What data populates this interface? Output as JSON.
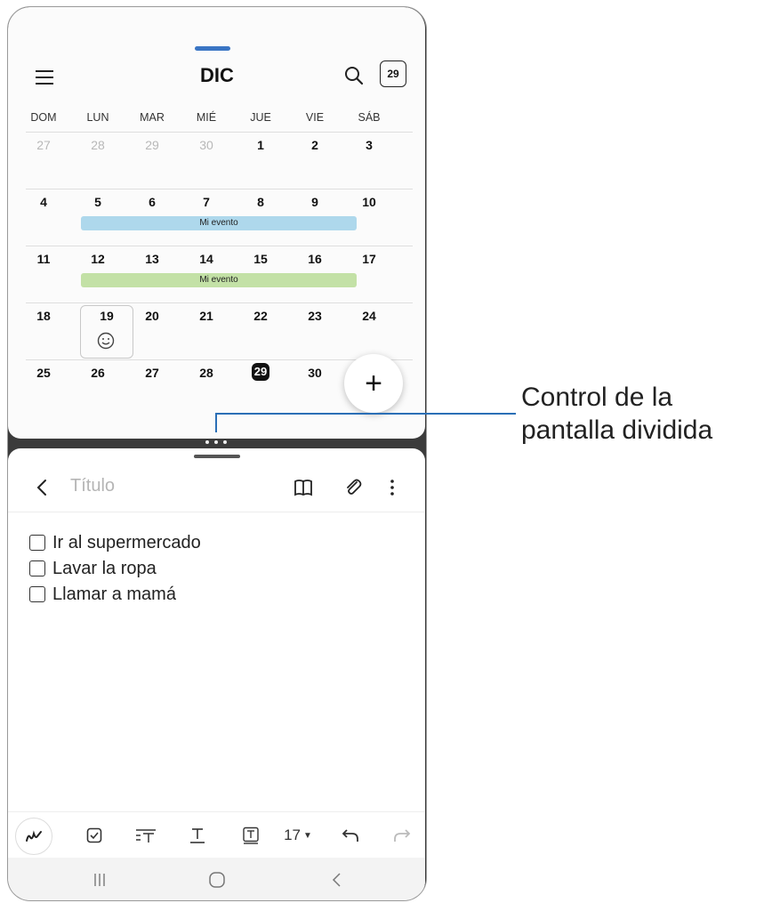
{
  "calendar": {
    "month": "DIC",
    "today_badge": "29",
    "weekdays": [
      "DOM",
      "LUN",
      "MAR",
      "MIÉ",
      "JUE",
      "VIE",
      "SÁB"
    ],
    "weeks": [
      {
        "days": [
          "27",
          "28",
          "29",
          "30",
          "1",
          "2",
          "3"
        ],
        "muted": [
          true,
          true,
          true,
          true,
          false,
          false,
          false
        ]
      },
      {
        "days": [
          "4",
          "5",
          "6",
          "7",
          "8",
          "9",
          "10"
        ],
        "event": {
          "label": "Mi evento",
          "color": "#aed8ec"
        }
      },
      {
        "days": [
          "11",
          "12",
          "13",
          "14",
          "15",
          "16",
          "17"
        ],
        "event": {
          "label": "Mi evento",
          "color": "#c3e1a6"
        }
      },
      {
        "days": [
          "18",
          "19",
          "20",
          "21",
          "22",
          "23",
          "24"
        ]
      },
      {
        "days": [
          "25",
          "26",
          "27",
          "28",
          "29",
          "30",
          ""
        ]
      }
    ],
    "selected_day": "29",
    "fab_label": "+"
  },
  "note": {
    "title_placeholder": "Título",
    "checklist": [
      "Ir al supermercado",
      "Lavar la ropa",
      "Llamar a mamá"
    ],
    "font_size": "17"
  },
  "callout": {
    "line1": "Control de la",
    "line2": "pantalla dividida",
    "color": "#2b6fb6"
  }
}
